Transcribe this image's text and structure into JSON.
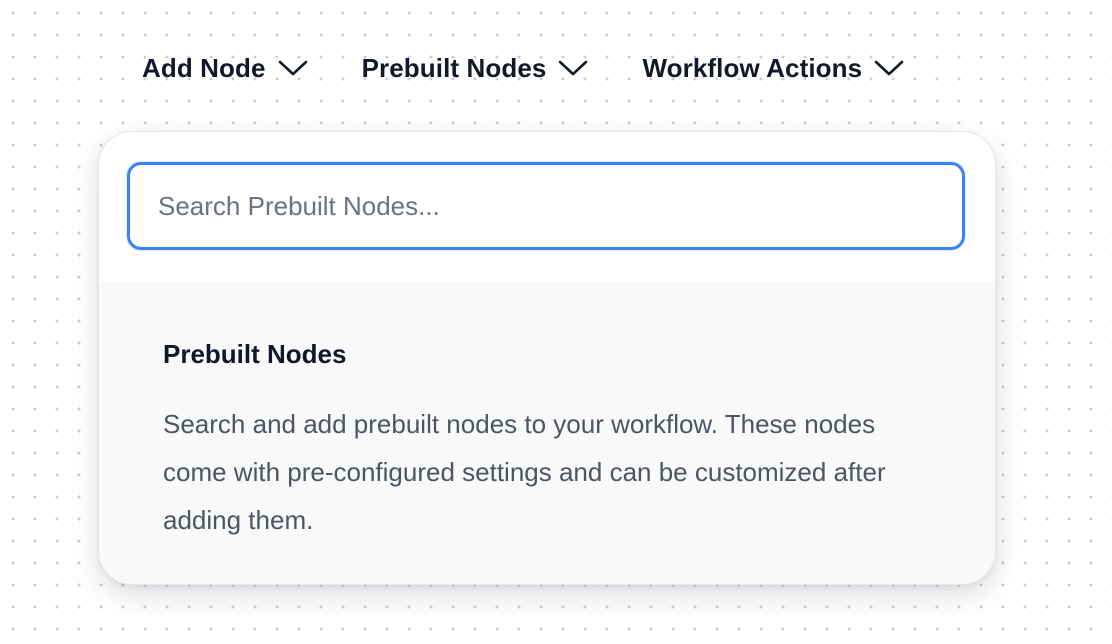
{
  "menubar": {
    "items": [
      {
        "label": "Add Node",
        "icon": "chevron-down-icon"
      },
      {
        "label": "Prebuilt Nodes",
        "icon": "chevron-down-icon"
      },
      {
        "label": "Workflow Actions",
        "icon": "chevron-down-icon"
      }
    ]
  },
  "dropdown": {
    "search": {
      "placeholder": "Search Prebuilt Nodes...",
      "value": ""
    },
    "info": {
      "heading": "Prebuilt Nodes",
      "description": "Search and add prebuilt nodes to your workflow. These nodes come with pre-configured settings and can be customized after adding them."
    }
  },
  "colors": {
    "accent": "#3b82f6",
    "text_primary": "#111827",
    "text_secondary": "#4b5563",
    "panel_bg": "#f9f9fa",
    "canvas_dot": "#c9ccd1"
  }
}
